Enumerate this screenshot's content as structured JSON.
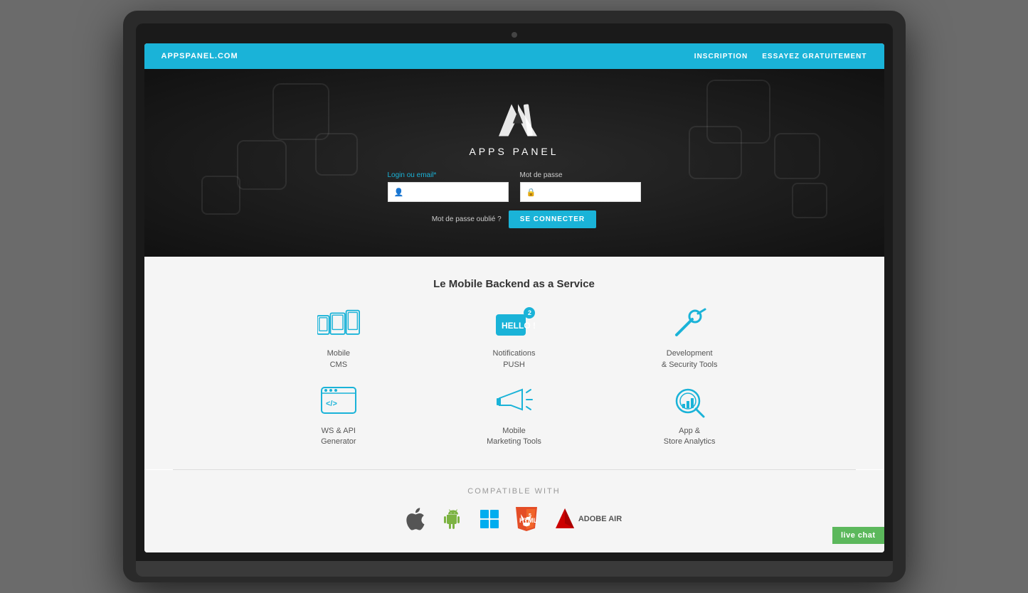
{
  "nav": {
    "brand": "APPSPANEL.COM",
    "links": [
      {
        "label": "INSCRIPTION",
        "name": "inscription-link"
      },
      {
        "label": "ESSAYEZ GRATUITEMENT",
        "name": "try-free-link"
      }
    ]
  },
  "hero": {
    "logo_text": "APPS PANEL",
    "login_label": "Login ou email",
    "login_label_asterisk": "*",
    "password_label": "Mot de passe",
    "forgot_text": "Mot de passe oublié ?",
    "submit_label": "SE CONNECTER"
  },
  "features": {
    "title": "Le Mobile Backend as a Service",
    "items": [
      {
        "label": "Mobile\nCMS",
        "name": "mobile-cms",
        "badge": null
      },
      {
        "label": "Notifications\nPUSH",
        "name": "notifications-push",
        "badge": "2"
      },
      {
        "label": "Development\n& Security Tools",
        "name": "dev-security-tools",
        "badge": null
      },
      {
        "label": "WS & API\nGenerator",
        "name": "ws-api-generator",
        "badge": null
      },
      {
        "label": "Mobile\nMarketing Tools",
        "name": "mobile-marketing-tools",
        "badge": null
      },
      {
        "label": "App &\nStore Analytics",
        "name": "app-store-analytics",
        "badge": null
      }
    ]
  },
  "compatible": {
    "title": "COMPATIBLE WITH",
    "platforms": [
      "Apple iOS",
      "Android",
      "Windows",
      "HTML5",
      "Adobe AIR"
    ]
  },
  "live_chat": {
    "label": "live chat"
  }
}
